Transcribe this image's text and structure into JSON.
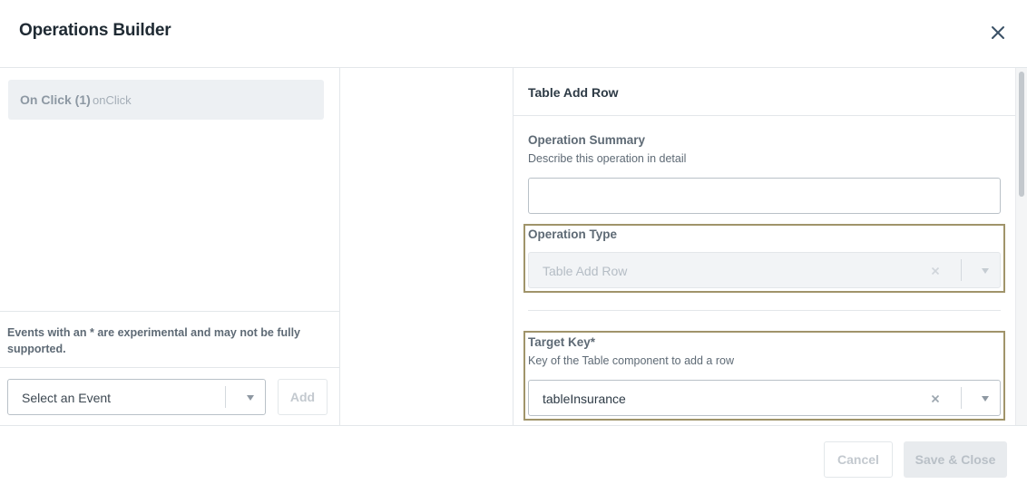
{
  "modal": {
    "title": "Operations Builder"
  },
  "events": {
    "items": [
      {
        "name": "On Click (1)",
        "key": "onClick"
      }
    ],
    "note": "Events with an * are experimental and may not be fully supported.",
    "select": {
      "value": "Select an Event"
    },
    "add_label": "Add"
  },
  "detail": {
    "title": "Table Add Row",
    "summary": {
      "label": "Operation Summary",
      "description": "Describe this operation in detail",
      "value": ""
    },
    "operation_type": {
      "label": "Operation Type",
      "value": "Table Add Row"
    },
    "target_key": {
      "label": "Target Key*",
      "description": "Key of the Table component to add a row",
      "value": "tableInsurance"
    }
  },
  "footer": {
    "cancel_label": "Cancel",
    "save_label": "Save & Close"
  },
  "colors": {
    "highlight_border": "#a0946a",
    "selected_event_bg": "#edf0f3",
    "text_primary": "#2d3a45",
    "text_muted": "#5e6a75",
    "disabled_text": "#c3c9cf"
  },
  "icons": {
    "close": "close-icon",
    "clear": "clear-icon",
    "dropdown": "chevron-down-icon"
  }
}
